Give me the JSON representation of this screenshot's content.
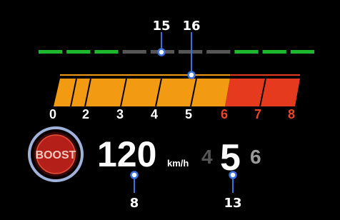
{
  "callouts": {
    "shift_lamps": "15",
    "tach_bar": "16",
    "speed": "8",
    "gear": "13"
  },
  "shift_lamps": {
    "states": [
      "green",
      "green",
      "green",
      "gray",
      "gray",
      "gray",
      "gray",
      "green",
      "green",
      "green"
    ],
    "colors": {
      "green": "#1fb82c",
      "gray": "#555555"
    }
  },
  "tachometer": {
    "labels": [
      {
        "text": "0",
        "redline": false
      },
      {
        "text": "2",
        "redline": false
      },
      {
        "text": "3",
        "redline": false
      },
      {
        "text": "4",
        "redline": false
      },
      {
        "text": "5",
        "redline": false
      },
      {
        "text": "6",
        "redline": true
      },
      {
        "text": "7",
        "redline": true
      },
      {
        "text": "8",
        "redline": true
      }
    ],
    "rpm_max": 8,
    "redline_start": 6,
    "colors": {
      "normal": "#f29a12",
      "redline": "#e63a1e",
      "label_redline": "#e8452a"
    }
  },
  "boost": {
    "label": "BOOST",
    "colors": {
      "ring": "#9fb2d9",
      "fill": "#b51f1a",
      "text": "#f2c9c0"
    }
  },
  "speedometer": {
    "value": "120",
    "unit": "km/h"
  },
  "gear_indicator": {
    "previous": "4",
    "current": "5",
    "next": "6",
    "colors": {
      "dim": "#555555",
      "current": "#ffffff",
      "next": "#9a9a9a"
    }
  }
}
